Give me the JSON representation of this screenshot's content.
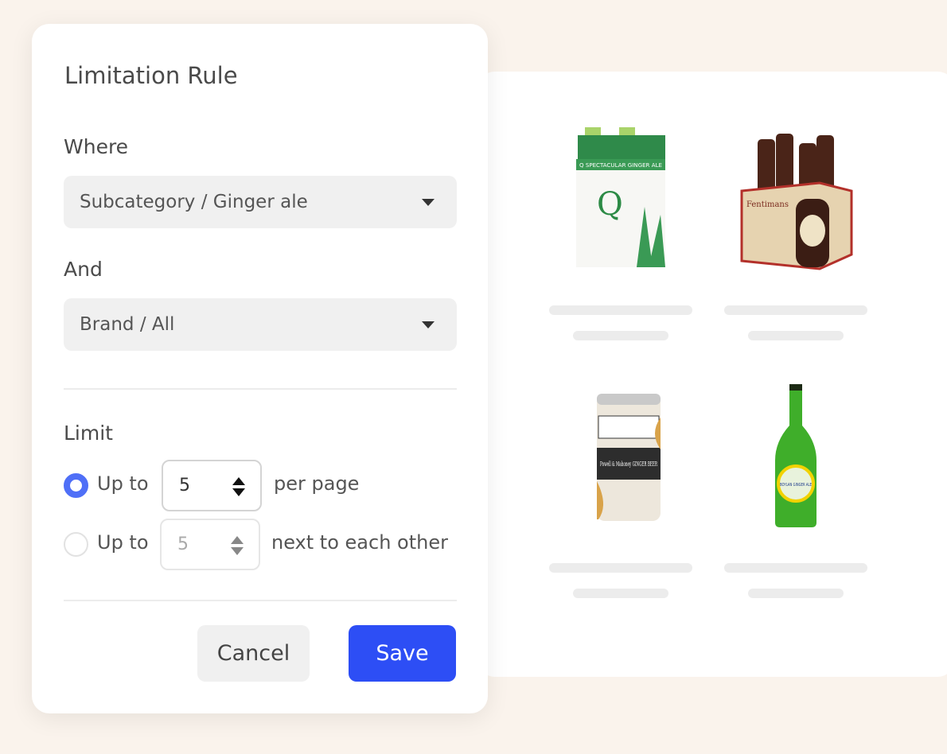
{
  "dialog": {
    "title": "Limitation Rule",
    "where_label": "Where",
    "where_value": "Subcategory / Ginger ale",
    "and_label": "And",
    "and_value": "Brand / All",
    "limit_label": "Limit",
    "options": [
      {
        "prefix": "Up to",
        "value": "5",
        "suffix": "per page",
        "selected": true
      },
      {
        "prefix": "Up to",
        "value": "5",
        "suffix": "next to each other",
        "selected": false
      }
    ],
    "cancel_label": "Cancel",
    "save_label": "Save"
  },
  "colors": {
    "accent": "#2d4ef5",
    "radio_selected": "#4f6ff7",
    "background": "#faf3ec"
  },
  "products": [
    {
      "image": "Q Spectacular Ginger Ale 4-pack",
      "lettering": "Q SPECTACULAR GINGER ALE"
    },
    {
      "image": "Fentimans ginger beer 4-pack",
      "lettering": "Fentimans"
    },
    {
      "image": "Powell & Mahoney Ginger Beer can",
      "lettering": "Powell & Mahoney GINGER BEER"
    },
    {
      "image": "Boylan Ginger Ale bottle",
      "lettering": "BOYLAN GINGER ALE"
    }
  ]
}
